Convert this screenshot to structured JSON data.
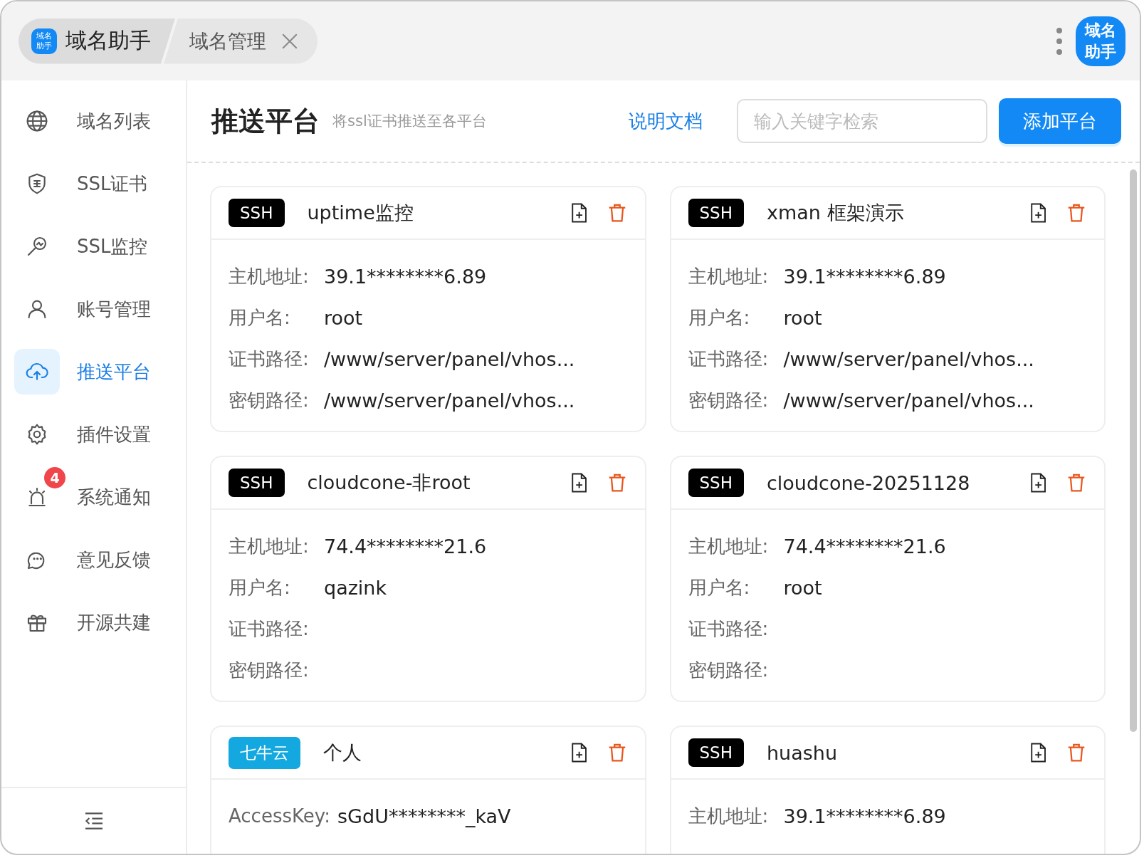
{
  "tabs": [
    {
      "label": "域名助手",
      "logo": "域名助手",
      "selected": true
    },
    {
      "label": "域名管理",
      "closable": true,
      "selected": false
    }
  ],
  "app_badge": {
    "line1": "域名",
    "line2": "助手"
  },
  "sidebar": {
    "items": [
      {
        "label": "域名列表",
        "selected": false
      },
      {
        "label": "SSL证书",
        "selected": false
      },
      {
        "label": "SSL监控",
        "selected": false
      },
      {
        "label": "账号管理",
        "selected": false
      },
      {
        "label": "推送平台",
        "selected": true
      },
      {
        "label": "插件设置",
        "selected": false
      },
      {
        "label": "系统通知",
        "badge": "4",
        "selected": false
      },
      {
        "label": "意见反馈",
        "selected": false
      },
      {
        "label": "开源共建",
        "selected": false
      }
    ]
  },
  "header": {
    "title": "推送平台",
    "subtitle": "将ssl证书推送至各平台",
    "docs_link": "说明文档",
    "search": {
      "placeholder": "输入关键字检索"
    },
    "add_button": "添加平台"
  },
  "cards": [
    {
      "tag": "SSH",
      "kind": "ssh",
      "name": "uptime监控",
      "fields": [
        {
          "label": "主机地址:",
          "value": "39.1********6.89"
        },
        {
          "label": "用户名:",
          "value": "root"
        },
        {
          "label": "证书路径:",
          "value": "/www/server/panel/vhos..."
        },
        {
          "label": "密钥路径:",
          "value": "/www/server/panel/vhos..."
        }
      ]
    },
    {
      "tag": "SSH",
      "kind": "ssh",
      "name": "xman 框架演示",
      "fields": [
        {
          "label": "主机地址:",
          "value": "39.1********6.89"
        },
        {
          "label": "用户名:",
          "value": "root"
        },
        {
          "label": "证书路径:",
          "value": "/www/server/panel/vhos..."
        },
        {
          "label": "密钥路径:",
          "value": "/www/server/panel/vhos..."
        }
      ]
    },
    {
      "tag": "SSH",
      "kind": "ssh",
      "name": "cloudcone-非root",
      "fields": [
        {
          "label": "主机地址:",
          "value": "74.4********21.6"
        },
        {
          "label": "用户名:",
          "value": "qazink"
        },
        {
          "label": "证书路径:"
        },
        {
          "label": "密钥路径:"
        }
      ]
    },
    {
      "tag": "SSH",
      "kind": "ssh",
      "name": "cloudcone-20251128",
      "fields": [
        {
          "label": "主机地址:",
          "value": "74.4********21.6"
        },
        {
          "label": "用户名:",
          "value": "root"
        },
        {
          "label": "证书路径:"
        },
        {
          "label": "密钥路径:"
        }
      ]
    },
    {
      "tag": "七牛云",
      "kind": "qiniu",
      "name": "个人",
      "fields": [
        {
          "label": "AccessKey:",
          "value": "sGdU********_kaV"
        }
      ]
    },
    {
      "tag": "SSH",
      "kind": "ssh",
      "name": "huashu",
      "fields": [
        {
          "label": "主机地址:",
          "value": "39.1********6.89"
        }
      ]
    }
  ]
}
